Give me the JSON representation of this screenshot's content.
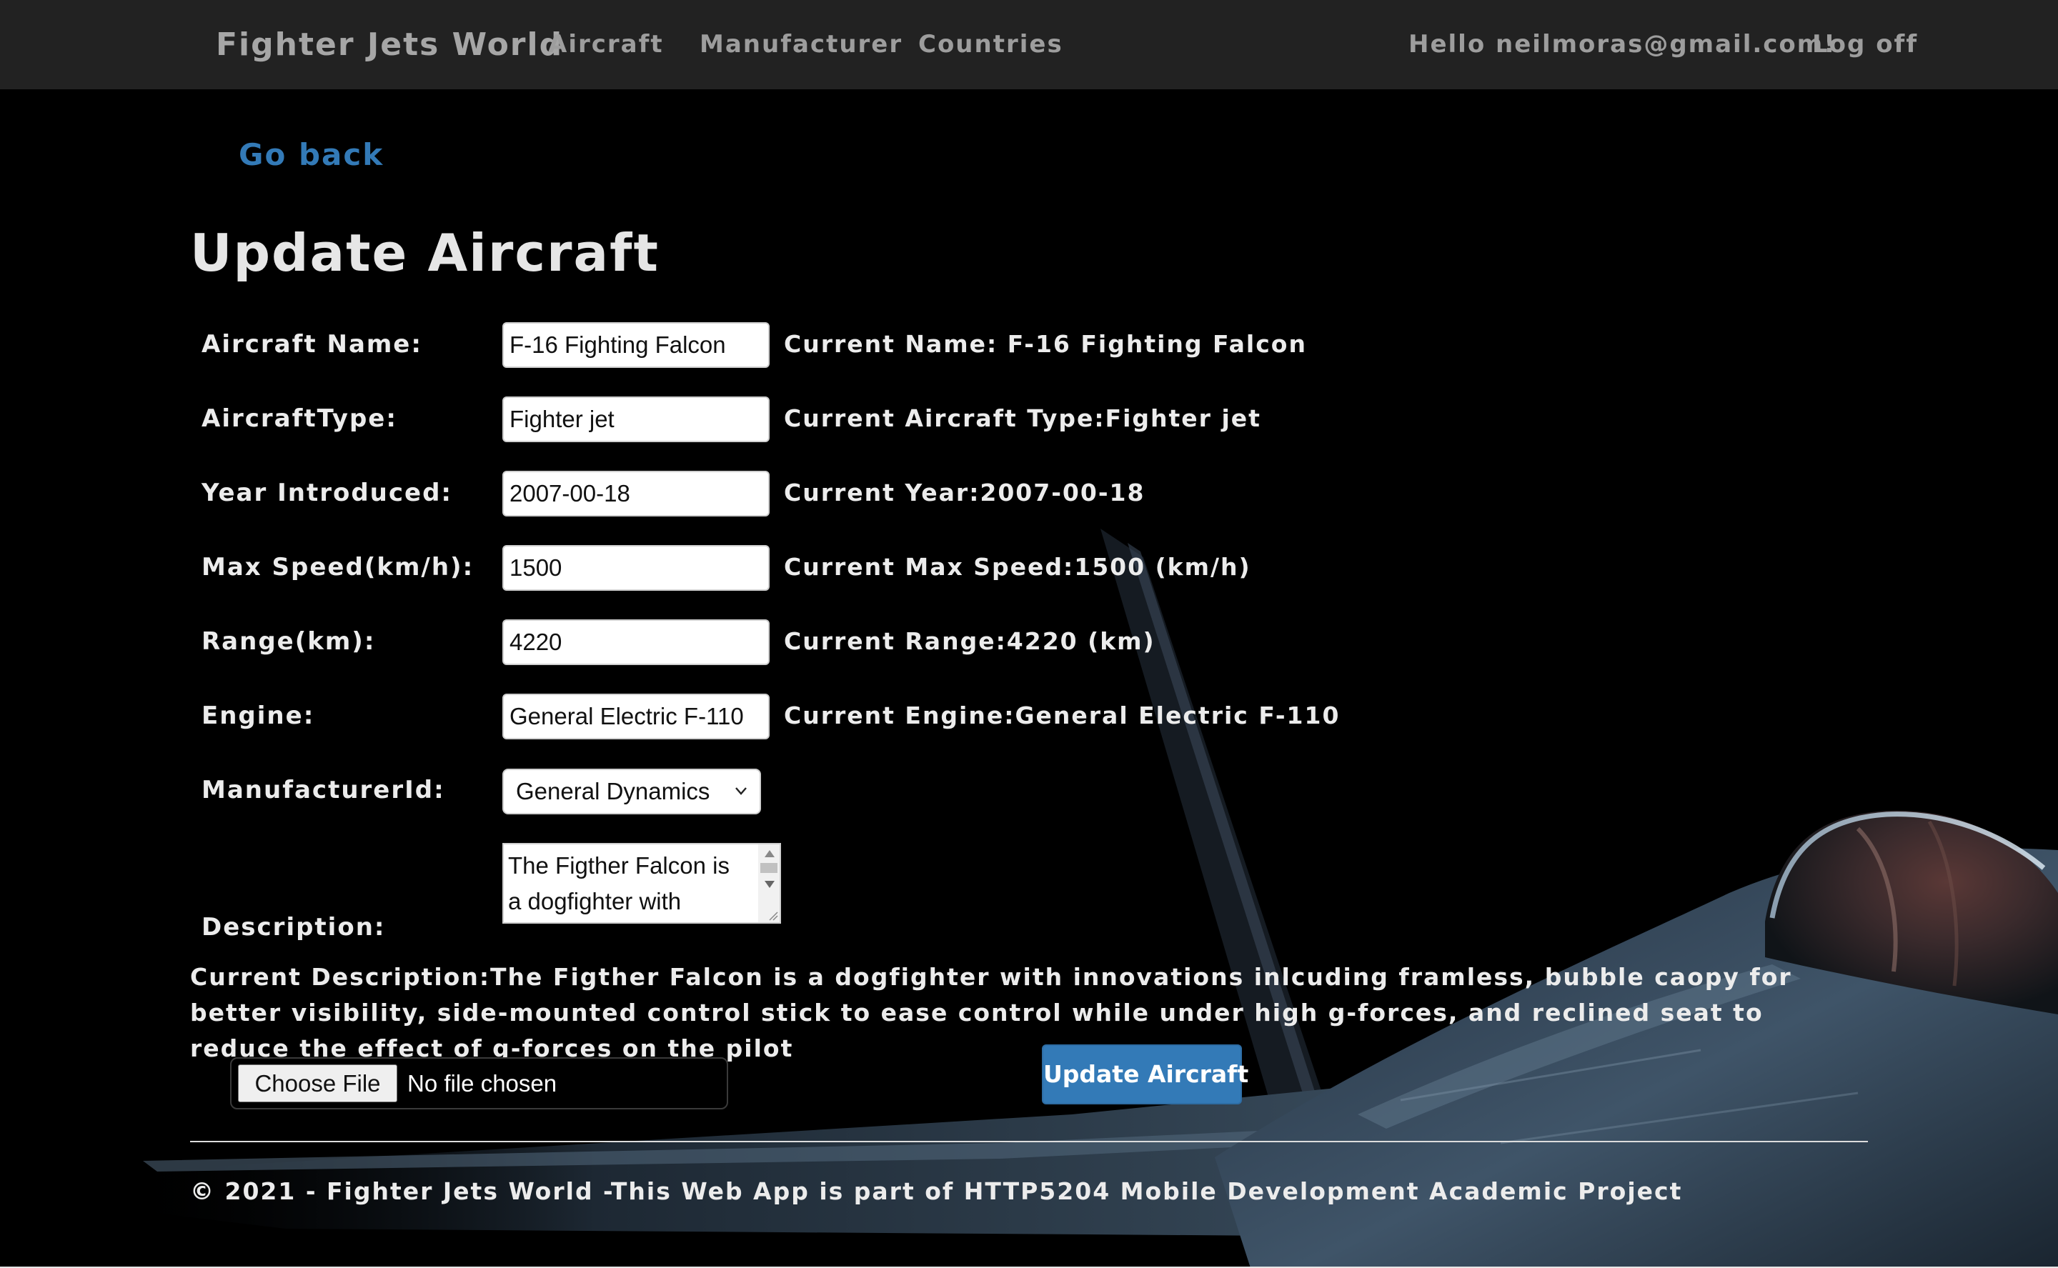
{
  "navbar": {
    "brand": "Fighter Jets World",
    "links": [
      "Aircraft",
      "Manufacturer",
      "Countries"
    ],
    "greeting": "Hello neilmoras@gmail.com!",
    "logoff": "Log off"
  },
  "go_back": "Go back",
  "page_title": "Update Aircraft",
  "form": {
    "fields": [
      {
        "label": "Aircraft Name:",
        "value": "F-16 Fighting Falcon",
        "current": "Current Name: F-16 Fighting Falcon"
      },
      {
        "label": "AircraftType:",
        "value": "Fighter jet",
        "current": "Current Aircraft Type:Fighter jet"
      },
      {
        "label": "Year Introduced:",
        "value": "2007-00-18",
        "current": "Current Year:2007-00-18"
      },
      {
        "label": "Max Speed(km/h):",
        "value": "1500",
        "current": "Current Max Speed:1500 (km/h)"
      },
      {
        "label": "Range(km):",
        "value": "4220",
        "current": "Current Range:4220 (km)"
      },
      {
        "label": "Engine:",
        "value": "General Electric F-110",
        "current": "Current Engine:General Electric F-110"
      }
    ],
    "manufacturer": {
      "label": "ManufacturerId:",
      "selected": "General Dynamics"
    },
    "description": {
      "label": "Description:",
      "value": "The Figther Falcon is a dogfighter with",
      "current": "Current Description:The Figther Falcon is a dogfighter with innovations inlcuding framless, bubble caopy for better visibility, side-mounted control stick to ease control while under high g-forces, and reclined seat to reduce the effect of g-forces on the pilot"
    },
    "file": {
      "button": "Choose File",
      "status": "No file chosen"
    },
    "submit": "Update Aircraft"
  },
  "footer": "© 2021 - Fighter Jets World -This Web App is part of HTTP5204 Mobile Development Academic Project",
  "colors": {
    "navbar_bg": "#222222",
    "nav_text": "#9d9d9d",
    "link": "#337ab7",
    "button": "#337ab7",
    "page_bg": "#000000"
  },
  "icons": [
    "chevron-down-icon",
    "scroll-up-arrow-icon",
    "scroll-down-arrow-icon",
    "resize-grip-icon"
  ]
}
